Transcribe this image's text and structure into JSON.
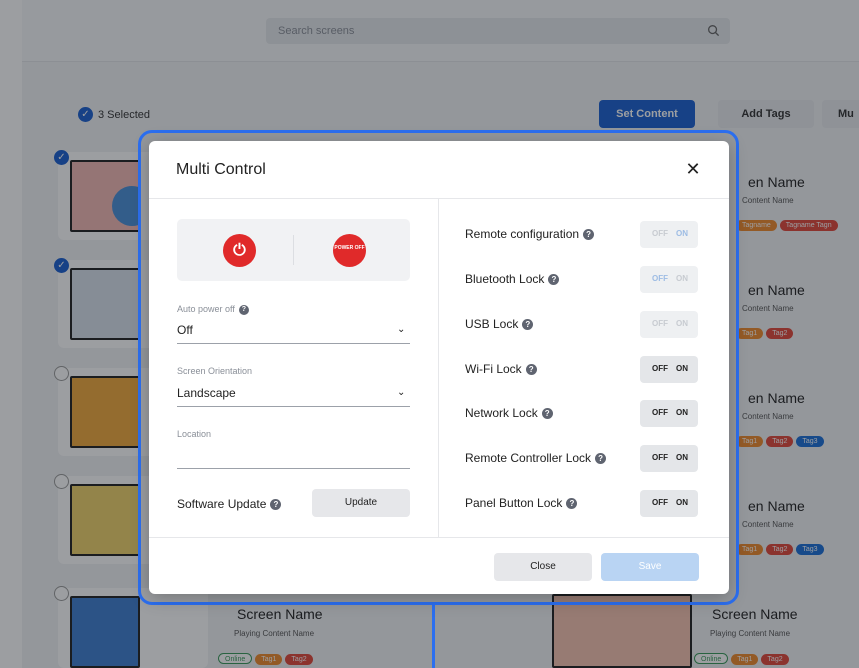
{
  "app": {
    "search_placeholder": "Search screens",
    "selected_text": "3 Selected",
    "set_content_label": "Set Content",
    "add_tags_label": "Add Tags",
    "more_label": "Mu",
    "screen_name": "Screen Name",
    "screen_name_cut": "en Name",
    "playing_content": "Playing Content Name",
    "content_name_cut": "Content Name",
    "tags_row1": [
      "Tagname",
      "Tagname Tagn"
    ],
    "tags_row2": [
      "Tag1",
      "Tag2"
    ],
    "tags_row3": [
      "Tag1",
      "Tag2",
      "Tag3"
    ],
    "tags_row4": [
      "Tag1",
      "Tag2",
      "Tag3"
    ],
    "bottom_tags_left": [
      "Online",
      "Tag1",
      "Tag2"
    ],
    "bottom_tags_right": [
      "Online",
      "Tag1",
      "Tag2"
    ]
  },
  "modal": {
    "title": "Multi Control",
    "power_on_icon": "power-icon",
    "power_off_text": "POWER OFF",
    "auto_power_off_label": "Auto power off",
    "auto_power_off_value": "Off",
    "screen_orientation_label": "Screen Orientation",
    "screen_orientation_value": "Landscape",
    "location_label": "Location",
    "software_update_label": "Software Update",
    "update_button": "Update",
    "rows": [
      {
        "label": "Remote configuration",
        "off": "OFF",
        "on": "ON",
        "state": "on",
        "enabled": false
      },
      {
        "label": "Bluetooth Lock",
        "off": "OFF",
        "on": "ON",
        "state": "off",
        "enabled": false
      },
      {
        "label": "USB Lock",
        "off": "OFF",
        "on": "ON",
        "state": "none",
        "enabled": false
      },
      {
        "label": "Wi-Fi Lock",
        "off": "OFF",
        "on": "ON",
        "state": "none",
        "enabled": true
      },
      {
        "label": "Network Lock",
        "off": "OFF",
        "on": "ON",
        "state": "none",
        "enabled": true
      },
      {
        "label": "Remote Controller Lock",
        "off": "OFF",
        "on": "ON",
        "state": "none",
        "enabled": true
      },
      {
        "label": "Panel Button Lock",
        "off": "OFF",
        "on": "ON",
        "state": "none",
        "enabled": true
      }
    ],
    "close_button": "Close",
    "save_button": "Save"
  },
  "colors": {
    "accent": "#1a5fd0",
    "highlight": "#2c6ff0",
    "power_red": "#e02a2a",
    "save_disabled": "#b9d4f3"
  }
}
